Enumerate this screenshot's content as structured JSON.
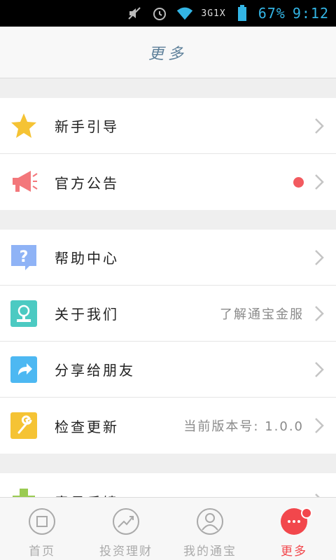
{
  "status": {
    "network": "3G1X",
    "battery": "67%",
    "time": "9:12"
  },
  "header": {
    "title": "更多"
  },
  "groups": [
    [
      {
        "label": "新手引导",
        "value": "",
        "icon": "star-icon",
        "color": "#f5c334"
      },
      {
        "label": "官方公告",
        "value": "",
        "icon": "megaphone-icon",
        "color": "#f3777b",
        "dot": true
      }
    ],
    [
      {
        "label": "帮助中心",
        "value": "",
        "icon": "help-icon",
        "color": "#8fb3f6"
      },
      {
        "label": "关于我们",
        "value": "了解通宝金服",
        "icon": "about-icon",
        "color": "#4ccac2"
      },
      {
        "label": "分享给朋友",
        "value": "",
        "icon": "share-icon",
        "color": "#4db8f2"
      },
      {
        "label": "检查更新",
        "value": "当前版本号: 1.0.0",
        "icon": "wrench-icon",
        "color": "#f5c334"
      }
    ],
    [
      {
        "label": "意见反馈",
        "value": "",
        "icon": "feedback-icon",
        "color": "#9acb52"
      }
    ]
  ],
  "tabs": [
    {
      "label": "首页",
      "icon": "home-icon",
      "active": false
    },
    {
      "label": "投资理财",
      "icon": "invest-icon",
      "active": false
    },
    {
      "label": "我的通宝",
      "icon": "user-icon",
      "active": false
    },
    {
      "label": "更多",
      "icon": "more-icon",
      "active": true
    }
  ],
  "colors": {
    "accent": "#f2474c",
    "title": "#5d7f99"
  }
}
